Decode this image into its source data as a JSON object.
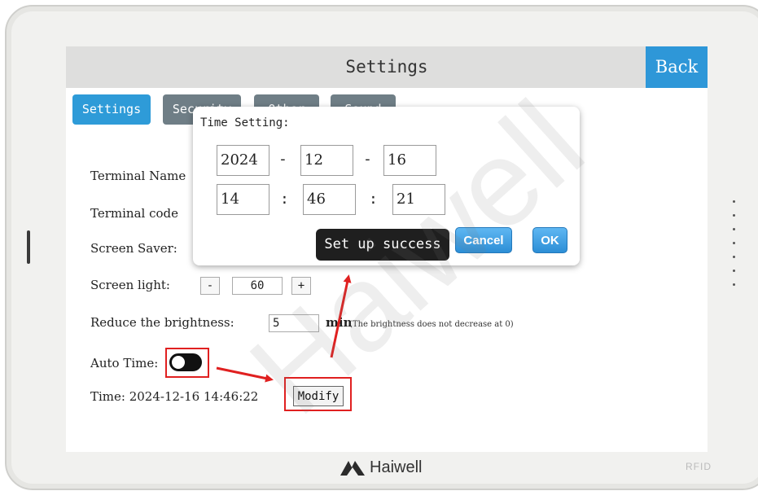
{
  "header": {
    "title": "Settings",
    "back_label": "Back"
  },
  "tabs": [
    {
      "label": "Settings",
      "active": true
    },
    {
      "label": "Security",
      "active": false
    },
    {
      "label": "Other",
      "active": false
    },
    {
      "label": "Sound",
      "active": false
    }
  ],
  "form": {
    "terminal_name_label": "Terminal Name",
    "terminal_code_label": "Terminal code",
    "screen_saver_label": "Screen Saver:",
    "screen_light_label": "Screen light:",
    "screen_light_minus": "-",
    "screen_light_value": "60",
    "screen_light_plus": "+",
    "reduce_brightness_label": "Reduce the brightness:",
    "reduce_brightness_value": "5",
    "reduce_brightness_unit": "min",
    "reduce_brightness_note": "(The brightness does not decrease at 0)",
    "auto_time_label": "Auto Time:",
    "auto_time_on": false,
    "time_label": "Time: 2024-12-16 14:46:22",
    "modify_label": "Modify"
  },
  "dialog": {
    "title": "Time Setting:",
    "year": "2024",
    "month": "12",
    "day": "16",
    "hour": "14",
    "minute": "46",
    "second": "21",
    "date_separator": "-",
    "time_separator": ":",
    "toast": "Set up success",
    "cancel_label": "Cancel",
    "ok_label": "OK"
  },
  "footer": {
    "brand": "Haiwell",
    "rfid": "RFID"
  },
  "watermark": "Haiwell",
  "colors": {
    "accent": "#2e97d8",
    "highlight": "#e02020",
    "tab_inactive": "#6f7e86"
  }
}
